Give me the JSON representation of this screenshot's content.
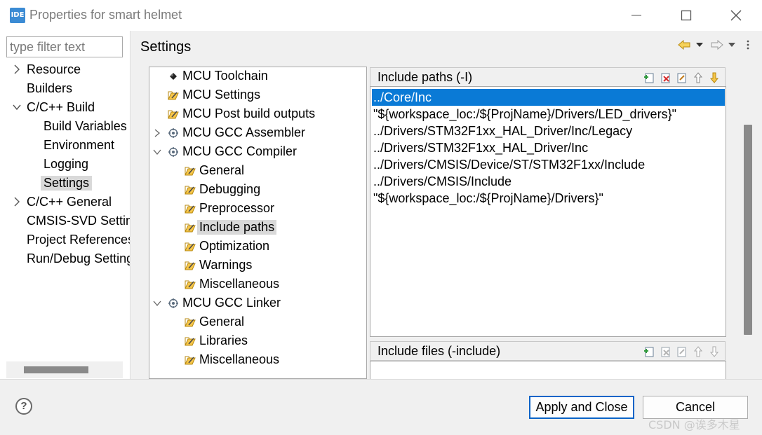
{
  "window": {
    "app_icon_text": "IDE",
    "title": "Properties for smart helmet"
  },
  "left_nav": {
    "filter_placeholder": "type filter text",
    "items": [
      {
        "label": "Resource",
        "arrow": "right"
      },
      {
        "label": "Builders",
        "arrow": ""
      },
      {
        "label": "C/C++ Build",
        "arrow": "down"
      },
      {
        "label": "Build Variables",
        "arrow": ""
      },
      {
        "label": "Environment",
        "arrow": ""
      },
      {
        "label": "Logging",
        "arrow": ""
      },
      {
        "label": "Settings",
        "arrow": "",
        "selected": true
      },
      {
        "label": "C/C++ General",
        "arrow": "right"
      },
      {
        "label": "CMSIS-SVD Settings",
        "arrow": ""
      },
      {
        "label": "Project References",
        "arrow": ""
      },
      {
        "label": "Run/Debug Settings",
        "arrow": ""
      }
    ]
  },
  "main": {
    "title": "Settings",
    "tool_tree": [
      {
        "label": "MCU Toolchain",
        "icon": "diamond-icon"
      },
      {
        "label": "MCU Settings",
        "icon": "tool-settings-icon"
      },
      {
        "label": "MCU Post build outputs",
        "icon": "tool-settings-icon"
      },
      {
        "label": "MCU GCC Assembler",
        "icon": "gear-tool-icon",
        "arrow": "right"
      },
      {
        "label": "MCU GCC Compiler",
        "icon": "gear-tool-icon",
        "arrow": "down"
      },
      {
        "label": "General",
        "icon": "tool-settings-icon"
      },
      {
        "label": "Debugging",
        "icon": "tool-settings-icon"
      },
      {
        "label": "Preprocessor",
        "icon": "tool-settings-icon"
      },
      {
        "label": "Include paths",
        "icon": "tool-settings-icon",
        "selected": true
      },
      {
        "label": "Optimization",
        "icon": "tool-settings-icon"
      },
      {
        "label": "Warnings",
        "icon": "tool-settings-icon"
      },
      {
        "label": "Miscellaneous",
        "icon": "tool-settings-icon"
      },
      {
        "label": "MCU GCC Linker",
        "icon": "gear-tool-icon",
        "arrow": "down"
      },
      {
        "label": "General",
        "icon": "tool-settings-icon"
      },
      {
        "label": "Libraries",
        "icon": "tool-settings-icon"
      },
      {
        "label": "Miscellaneous",
        "icon": "tool-settings-icon"
      }
    ],
    "include_paths": {
      "title": "Include paths (-I)",
      "items": [
        "../Core/Inc",
        "\"${workspace_loc:/${ProjName}/Drivers/LED_drivers}\"",
        "../Drivers/STM32F1xx_HAL_Driver/Inc/Legacy",
        "../Drivers/STM32F1xx_HAL_Driver/Inc",
        "../Drivers/CMSIS/Device/ST/STM32F1xx/Include",
        "../Drivers/CMSIS/Include",
        "\"${workspace_loc:/${ProjName}/Drivers}\""
      ]
    },
    "include_files": {
      "title": "Include files (-include)"
    }
  },
  "footer": {
    "help": "?",
    "apply_label": "Apply and Close",
    "cancel_label": "Cancel",
    "watermark": "CSDN @诶多木星"
  },
  "colors": {
    "selection": "#0a7ad6",
    "accent_border": "#0a64c8",
    "panel_bg": "#f0f0f0"
  }
}
